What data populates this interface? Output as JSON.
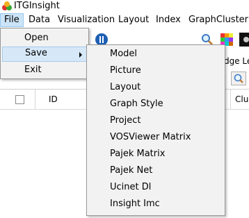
{
  "window": {
    "title": "ITGInsight"
  },
  "menubar": {
    "items": [
      {
        "label": "File"
      },
      {
        "label": "Data"
      },
      {
        "label": "Visualization"
      },
      {
        "label": "Layout"
      },
      {
        "label": "Index"
      },
      {
        "label": "GraphCluster"
      }
    ]
  },
  "toolbar": {
    "edge_label_partial": "dge Le"
  },
  "grid": {
    "columns": [
      {
        "label": "ID"
      },
      {
        "label": "Clu"
      }
    ]
  },
  "file_menu": {
    "items": [
      {
        "label": "Open"
      },
      {
        "label": "Save",
        "submenu": true,
        "highlighted": true
      },
      {
        "label": "Exit"
      }
    ]
  },
  "save_menu": {
    "items": [
      {
        "label": "Model"
      },
      {
        "label": "Picture"
      },
      {
        "label": "Layout"
      },
      {
        "label": "Graph Style"
      },
      {
        "label": "Project"
      },
      {
        "label": "VOSViewer Matrix"
      },
      {
        "label": "Pajek Matrix"
      },
      {
        "label": "Pajek Net"
      },
      {
        "label": "Ucinet Dl"
      },
      {
        "label": "Insight Imc"
      }
    ]
  },
  "icons": [
    "app-logo-icon",
    "stop-circle-icon",
    "search-icon",
    "color-grid-icon",
    "dark-image-icon",
    "chevron-right-icon"
  ],
  "colors": {
    "menu_highlight": "#cce4f7",
    "menu_bg": "#f2f2f2"
  }
}
